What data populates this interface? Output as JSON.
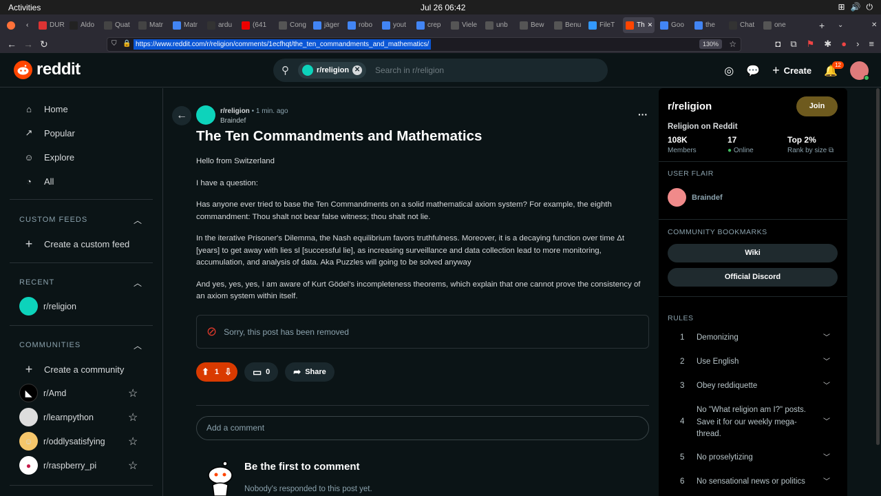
{
  "system": {
    "activities": "Activities",
    "clock": "Jul 26  06:42"
  },
  "tabs": [
    {
      "label": "DUR",
      "color": "#d33"
    },
    {
      "label": "Aldo",
      "color": "#222"
    },
    {
      "label": "Quat",
      "color": "#444"
    },
    {
      "label": "Matr",
      "color": "#444"
    },
    {
      "label": "Matr",
      "color": "#4285f4"
    },
    {
      "label": "ardu",
      "color": "#333"
    },
    {
      "label": "(641",
      "color": "#e00"
    },
    {
      "label": "Cong",
      "color": "#555"
    },
    {
      "label": "jäger",
      "color": "#4285f4"
    },
    {
      "label": "robo",
      "color": "#4285f4"
    },
    {
      "label": "yout",
      "color": "#4285f4"
    },
    {
      "label": "crep",
      "color": "#4285f4"
    },
    {
      "label": "Viele",
      "color": "#555"
    },
    {
      "label": "unb",
      "color": "#555"
    },
    {
      "label": "Bew",
      "color": "#555"
    },
    {
      "label": "Benu",
      "color": "#555"
    },
    {
      "label": "FileT",
      "color": "#39f"
    },
    {
      "label": "Th",
      "color": "#ff4500"
    },
    {
      "label": "Goo",
      "color": "#4285f4"
    },
    {
      "label": "the",
      "color": "#4285f4"
    },
    {
      "label": "Chat",
      "color": "#333"
    },
    {
      "label": "one",
      "color": "#555"
    }
  ],
  "browser": {
    "url": "https://www.reddit.com/r/religion/comments/1ecfhqt/the_ten_commandments_and_mathematics/",
    "zoom": "130%"
  },
  "header": {
    "logo": "reddit",
    "chip": "r/religion",
    "search_placeholder": "Search in r/religion",
    "create": "Create",
    "notifications": "12"
  },
  "sidebar": {
    "nav": [
      {
        "label": "Home"
      },
      {
        "label": "Popular"
      },
      {
        "label": "Explore"
      },
      {
        "label": "All"
      }
    ],
    "custom_feeds_title": "CUSTOM FEEDS",
    "create_feed": "Create a custom feed",
    "recent_title": "RECENT",
    "recent": "r/religion",
    "communities_title": "COMMUNITIES",
    "create_community": "Create a community",
    "communities": [
      {
        "label": "r/Amd",
        "color": "#000"
      },
      {
        "label": "r/learnpython",
        "color": "#ddd"
      },
      {
        "label": "r/oddlysatisfying",
        "color": "#f5c66b"
      },
      {
        "label": "r/raspberry_pi",
        "color": "#fff"
      }
    ]
  },
  "post": {
    "subreddit": "r/religion",
    "time": "• 1 min. ago",
    "author": "Braindef",
    "title": "The Ten Commandments and Mathematics",
    "paragraphs": [
      "Hello from Switzerland",
      "I have a question:",
      "Has anyone ever tried to base the Ten Commandments on a solid mathematical axiom system? For example, the eighth commandment: Thou shalt not bear false witness; thou shalt not lie.",
      "In the iterative Prisoner's Dilemma, the Nash equilibrium favors truthfulness. Moreover, it is a decaying function over time Δt [years] to get away with lies sl [successful lie], as increasing surveillance and data collection lead to more monitoring, accumulation, and analysis of data. Aka Puzzles will going to be solved anyway",
      "And yes, yes, yes, I am aware of Kurt Gödel's incompleteness theorems, which explain that one cannot prove the consistency of an axiom system within itself."
    ],
    "removed": "Sorry, this post has been removed",
    "votes": "1",
    "comments": "0",
    "share": "Share",
    "add_comment": "Add a comment",
    "first_comment": "Be the first to comment",
    "nobody": "Nobody's responded to this post yet."
  },
  "community": {
    "name": "r/religion",
    "join": "Join",
    "subtitle": "Religion on Reddit",
    "members": "108K",
    "members_label": "Members",
    "online": "17",
    "online_label": "Online",
    "rank": "Top 2%",
    "rank_label": "Rank by size",
    "flair_title": "USER FLAIR",
    "flair_user": "Braindef",
    "bookmarks_title": "COMMUNITY BOOKMARKS",
    "wiki": "Wiki",
    "discord": "Official Discord",
    "rules_title": "RULES",
    "rules": [
      {
        "n": "1",
        "t": "Demonizing"
      },
      {
        "n": "2",
        "t": "Use English"
      },
      {
        "n": "3",
        "t": "Obey reddiquette"
      },
      {
        "n": "4",
        "t": "No \"What religion am I?\" posts. Save it for our weekly mega-thread."
      },
      {
        "n": "5",
        "t": "No proselytizing"
      },
      {
        "n": "6",
        "t": "No sensational news or politics"
      }
    ]
  }
}
